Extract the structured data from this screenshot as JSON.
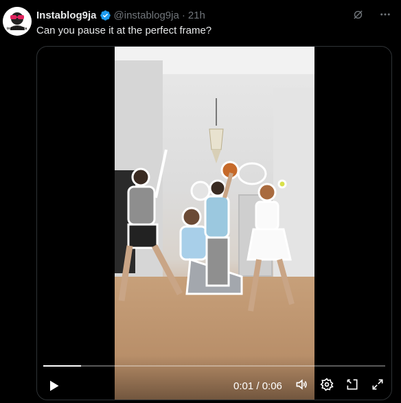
{
  "post": {
    "display_name": "Instablog9ja",
    "handle": "@instablog9ja",
    "separator": "·",
    "time": "21h",
    "text": "Can you pause it at the perfect frame?",
    "avatar_text": "instablog9ja"
  },
  "player": {
    "current_time": "0:01",
    "duration": "0:06",
    "time_label": "0:01 / 0:06",
    "progress": 0.11
  },
  "icons": {
    "verified": "verified-badge-icon",
    "grok": "grok-icon",
    "more": "more-icon",
    "play": "play-icon",
    "volume": "volume-icon",
    "settings": "settings-gear-icon",
    "pip": "picture-in-picture-icon",
    "fullscreen": "fullscreen-icon"
  },
  "colors": {
    "background": "#000000",
    "text_primary": "#e7e9ea",
    "text_secondary": "#71767b",
    "verified_blue": "#1d9bf0"
  }
}
